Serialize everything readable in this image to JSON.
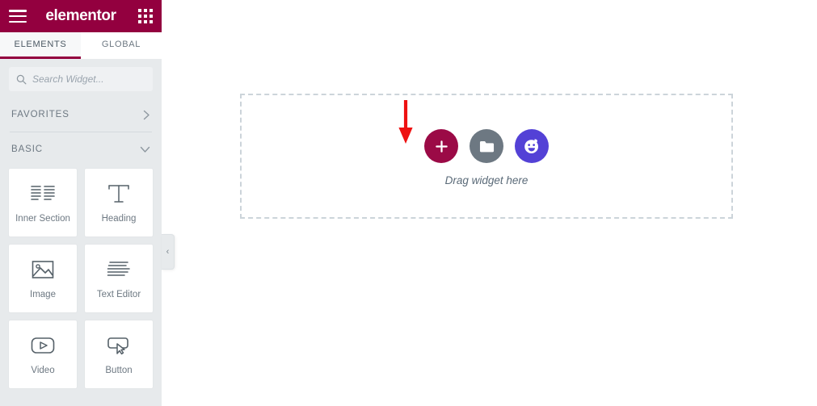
{
  "panel": {
    "header": {
      "menu_icon": "hamburger-icon",
      "brand": "elementor",
      "apps_icon": "grid-apps-icon"
    },
    "tabs": [
      {
        "label": "ELEMENTS",
        "active": true
      },
      {
        "label": "GLOBAL",
        "active": false
      }
    ],
    "search": {
      "placeholder": "Search Widget...",
      "value": "",
      "icon": "search-icon"
    },
    "sections": [
      {
        "label": "FAVORITES",
        "expanded": false,
        "chevron": "›"
      },
      {
        "label": "BASIC",
        "expanded": true,
        "chevron": "⌄"
      }
    ],
    "widgets": [
      {
        "label": "Inner Section",
        "icon": "inner-section-icon"
      },
      {
        "label": "Heading",
        "icon": "heading-icon"
      },
      {
        "label": "Image",
        "icon": "image-icon"
      },
      {
        "label": "Text Editor",
        "icon": "text-editor-icon"
      },
      {
        "label": "Video",
        "icon": "video-icon"
      },
      {
        "label": "Button",
        "icon": "button-icon"
      }
    ],
    "collapse_handle": {
      "icon": "chevron-left-icon",
      "glyph": "‹"
    }
  },
  "canvas": {
    "drag_label": "Drag widget here",
    "buttons": [
      {
        "name": "add-new-section-button",
        "icon": "plus-icon",
        "color": "#9b0a46"
      },
      {
        "name": "add-template-button",
        "icon": "folder-icon",
        "color": "#6d7882"
      },
      {
        "name": "happy-addons-button",
        "icon": "smiley-face-icon",
        "color": "#5341d6"
      }
    ],
    "annotation": {
      "name": "red-down-arrow",
      "color": "#ee1111",
      "points_to": "add-template-button"
    }
  },
  "theme": {
    "brand": "#93003f",
    "panel_bg": "#e7eaec",
    "canvas_bg": "#ffffff",
    "dashed_border": "#ccd4da",
    "text_muted": "#6d7882"
  }
}
